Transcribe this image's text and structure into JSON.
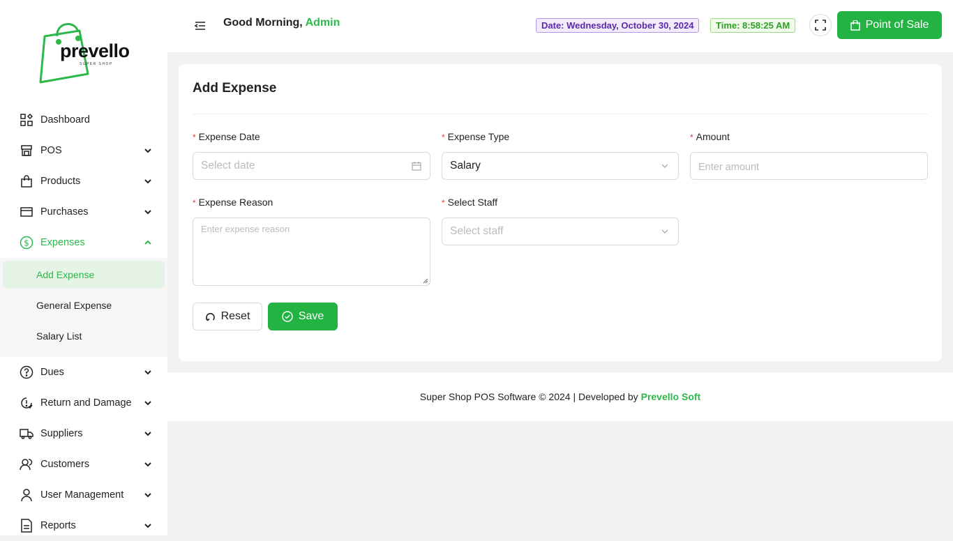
{
  "brand": {
    "name": "prevello",
    "tagline": "SUPER SHOP",
    "accent": "#22b343"
  },
  "sidebar": {
    "items": [
      {
        "label": "Dashboard",
        "icon": "dashboard-icon"
      },
      {
        "label": "POS",
        "icon": "store-icon",
        "expandable": true
      },
      {
        "label": "Products",
        "icon": "bag-icon",
        "expandable": true
      },
      {
        "label": "Purchases",
        "icon": "card-icon",
        "expandable": true
      },
      {
        "label": "Expenses",
        "icon": "dollar-icon",
        "expandable": true,
        "expanded": true,
        "active": true
      },
      {
        "label": "Dues",
        "icon": "question-icon",
        "expandable": true
      },
      {
        "label": "Return and Damage",
        "icon": "return-icon",
        "expandable": true
      },
      {
        "label": "Suppliers",
        "icon": "truck-icon",
        "expandable": true
      },
      {
        "label": "Customers",
        "icon": "customers-icon",
        "expandable": true
      },
      {
        "label": "User Management",
        "icon": "user-icon",
        "expandable": true
      },
      {
        "label": "Reports",
        "icon": "report-icon",
        "expandable": true
      }
    ],
    "expenses_sub": [
      {
        "label": "Add Expense",
        "active": true
      },
      {
        "label": "General Expense"
      },
      {
        "label": "Salary List"
      }
    ]
  },
  "header": {
    "greeting": "Good Morning,",
    "user": "Admin",
    "date": "Date: Wednesday, October 30, 2024",
    "time": "Time: 8:58:25 AM",
    "pos_label": "Point of Sale"
  },
  "form": {
    "title": "Add Expense",
    "expense_date": {
      "label": "Expense Date",
      "placeholder": "Select date"
    },
    "expense_type": {
      "label": "Expense Type",
      "value": "Salary"
    },
    "amount": {
      "label": "Amount",
      "placeholder": "Enter amount"
    },
    "expense_reason": {
      "label": "Expense Reason",
      "placeholder": "Enter expense reason"
    },
    "select_staff": {
      "label": "Select Staff",
      "placeholder": "Select staff"
    },
    "reset_label": "Reset",
    "save_label": "Save"
  },
  "footer": {
    "text": "Super Shop POS Software © 2024 | Developed by",
    "developer": "Prevello Soft"
  }
}
